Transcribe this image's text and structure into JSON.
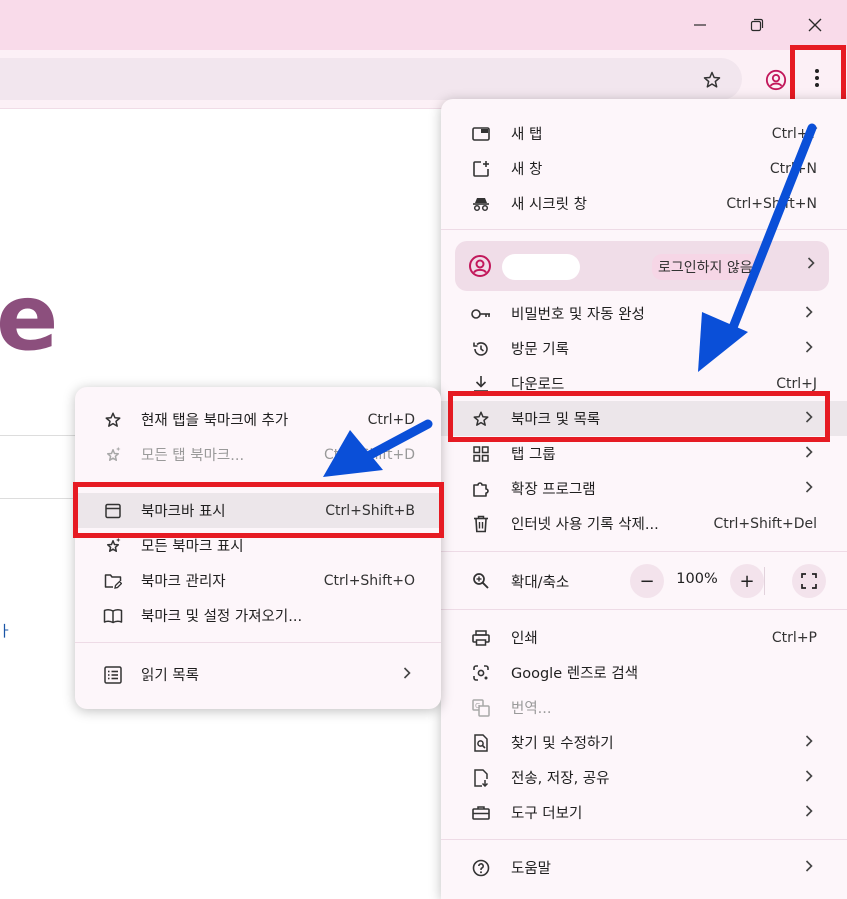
{
  "window_controls": {
    "minimize": "—",
    "restore": "❐",
    "close": "✕"
  },
  "page": {
    "logo_fragment": "e",
    "link_fragment": "ㅏ"
  },
  "main_menu": {
    "new_tab": {
      "label": "새 탭",
      "shortcut": "Ctrl+T"
    },
    "new_window": {
      "label": "새 창",
      "shortcut": "Ctrl+N"
    },
    "incognito": {
      "label": "새 시크릿 창",
      "shortcut": "Ctrl+Shift+N"
    },
    "profile": {
      "status": "로그인하지 않음"
    },
    "passwords": {
      "label": "비밀번호 및 자동 완성"
    },
    "history": {
      "label": "방문 기록"
    },
    "downloads": {
      "label": "다운로드",
      "shortcut": "Ctrl+J"
    },
    "bookmarks": {
      "label": "북마크 및 목록"
    },
    "tab_groups": {
      "label": "탭 그룹"
    },
    "extensions": {
      "label": "확장 프로그램"
    },
    "clear_data": {
      "label": "인터넷 사용 기록 삭제...",
      "shortcut": "Ctrl+Shift+Del"
    },
    "zoom": {
      "label": "확대/축소",
      "value": "100%",
      "minus": "−",
      "plus": "+"
    },
    "print": {
      "label": "인쇄",
      "shortcut": "Ctrl+P"
    },
    "lens": {
      "label": "Google 렌즈로 검색"
    },
    "translate": {
      "label": "번역..."
    },
    "find_edit": {
      "label": "찾기 및 수정하기"
    },
    "cast_save_share": {
      "label": "전송, 저장, 공유"
    },
    "more_tools": {
      "label": "도구 더보기"
    },
    "help": {
      "label": "도움말"
    }
  },
  "sub_menu": {
    "bookmark_tab": {
      "label": "현재 탭을 북마크에 추가",
      "shortcut": "Ctrl+D"
    },
    "bookmark_all_tabs": {
      "label": "모든 탭 북마크...",
      "shortcut": "Ctrl+Shift+D"
    },
    "show_bookmarks_bar": {
      "label": "북마크바 표시",
      "shortcut": "Ctrl+Shift+B"
    },
    "show_all_bookmarks": {
      "label": "모든 북마크 표시"
    },
    "bookmark_manager": {
      "label": "북마크 관리자",
      "shortcut": "Ctrl+Shift+O"
    },
    "import": {
      "label": "북마크 및 설정 가져오기..."
    },
    "reading_list": {
      "label": "읽기 목록"
    }
  },
  "colors": {
    "titlebar": "#f9dbea",
    "highlight": "#e61b23",
    "annotation_arrow": "#0a4fd8"
  }
}
